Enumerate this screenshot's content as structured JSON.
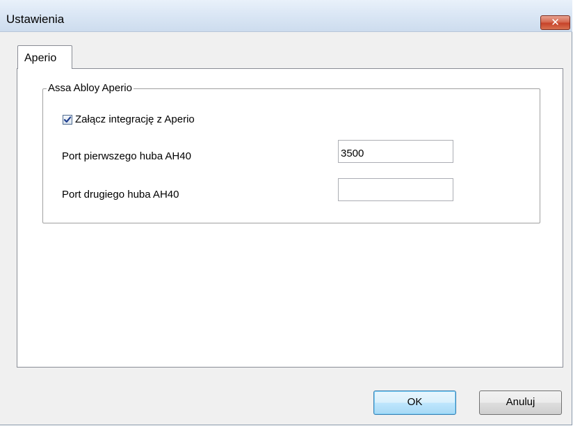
{
  "window": {
    "title": "Ustawienia",
    "close_symbol": "✕",
    "close_icon": "close-icon"
  },
  "tabs": [
    {
      "label": "Aperio",
      "selected": true
    }
  ],
  "group": {
    "title": "Assa Abloy Aperio",
    "enable_checkbox": {
      "label": "Załącz integrację z Aperio",
      "checked": true
    },
    "fields": [
      {
        "label": "Port pierwszego huba AH40",
        "value": "3500"
      },
      {
        "label": "Port drugiego huba AH40",
        "value": ""
      }
    ]
  },
  "buttons": {
    "ok_label": "OK",
    "cancel_label": "Anuluj"
  },
  "colors": {
    "close_button": "#c7432a",
    "default_button_border": "#3c7fb1"
  }
}
